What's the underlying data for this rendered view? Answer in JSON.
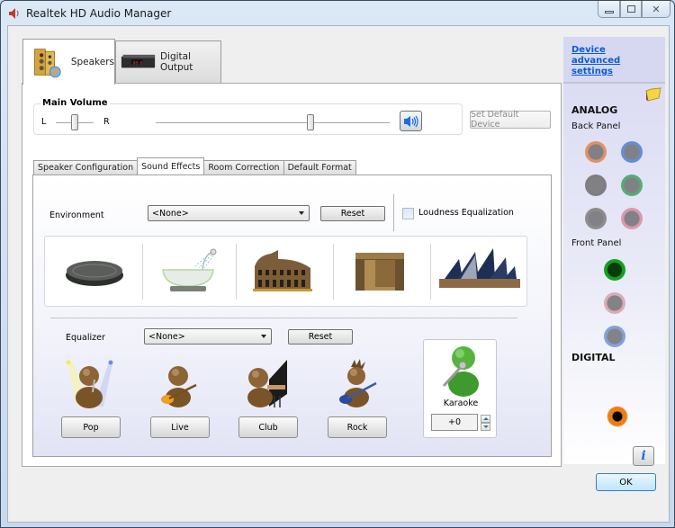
{
  "window": {
    "title": "Realtek HD Audio Manager",
    "controls": {
      "minimize": "minimize",
      "maximize": "maximize",
      "close": "close"
    }
  },
  "device_tabs": [
    {
      "label": "Speakers",
      "icon": "speakers-icon",
      "active": true
    },
    {
      "label": "Digital Output",
      "icon": "digital-output-icon",
      "active": false
    }
  ],
  "main_volume": {
    "title": "Main Volume",
    "balance_left_label": "L",
    "balance_right_label": "R",
    "balance_value_percent": 50,
    "volume_value_percent": 66,
    "mute_button_icon": "speaker-volume-icon"
  },
  "set_default_device_label": "Set Default Device",
  "sub_tabs": [
    {
      "label": "Speaker Configuration",
      "active": false
    },
    {
      "label": "Sound Effects",
      "active": true
    },
    {
      "label": "Room Correction",
      "active": false
    },
    {
      "label": "Default Format",
      "active": false
    }
  ],
  "sound_effects": {
    "environment_label": "Environment",
    "environment_selected": "<None>",
    "environment_reset_label": "Reset",
    "loudness_equalization_label": "Loudness Equalization",
    "loudness_equalization_checked": false,
    "environment_presets": [
      {
        "name": "sewer-pipe",
        "icon": "manhole-cover-icon"
      },
      {
        "name": "bathroom",
        "icon": "bathtub-icon"
      },
      {
        "name": "colosseum",
        "icon": "colosseum-icon"
      },
      {
        "name": "stone-room",
        "icon": "stone-room-icon"
      },
      {
        "name": "concert-hall",
        "icon": "opera-house-icon"
      }
    ],
    "equalizer_label": "Equalizer",
    "equalizer_selected": "<None>",
    "equalizer_reset_label": "Reset",
    "equalizer_presets": [
      {
        "label": "Pop",
        "icon": "pop-singer-icon"
      },
      {
        "label": "Live",
        "icon": "guitar-player-icon"
      },
      {
        "label": "Club",
        "icon": "piano-player-icon"
      },
      {
        "label": "Rock",
        "icon": "rock-guitarist-icon"
      }
    ],
    "karaoke": {
      "label": "Karaoke",
      "value": "+0",
      "icon": "karaoke-singer-icon"
    }
  },
  "side_panel": {
    "advanced_link": "Device advanced settings",
    "analog_heading": "ANALOG",
    "back_panel_label": "Back Panel",
    "back_panel_jacks": [
      {
        "name": "orange",
        "color": "#e0844a"
      },
      {
        "name": "blue",
        "color": "#4d7fd0"
      },
      {
        "name": "black",
        "color": "#6c6c6c"
      },
      {
        "name": "green",
        "color": "#3da35a"
      },
      {
        "name": "gray",
        "color": "#7d7d7d"
      },
      {
        "name": "pink",
        "color": "#d98a9b"
      }
    ],
    "front_panel_label": "Front Panel",
    "front_panel_jacks": [
      {
        "name": "green",
        "color": "#14a020",
        "active": true
      },
      {
        "name": "pink",
        "color": "#d8a0aa",
        "active": false
      },
      {
        "name": "blue",
        "color": "#6d94d6",
        "active": false
      }
    ],
    "digital_heading": "DIGITAL",
    "digital_jack_color": "#f07d12"
  },
  "bottom": {
    "info_icon": "i",
    "ok_label": "OK"
  },
  "colors": {
    "link": "#0b5bd3",
    "side_panel_bg": "#d8d9f2"
  }
}
